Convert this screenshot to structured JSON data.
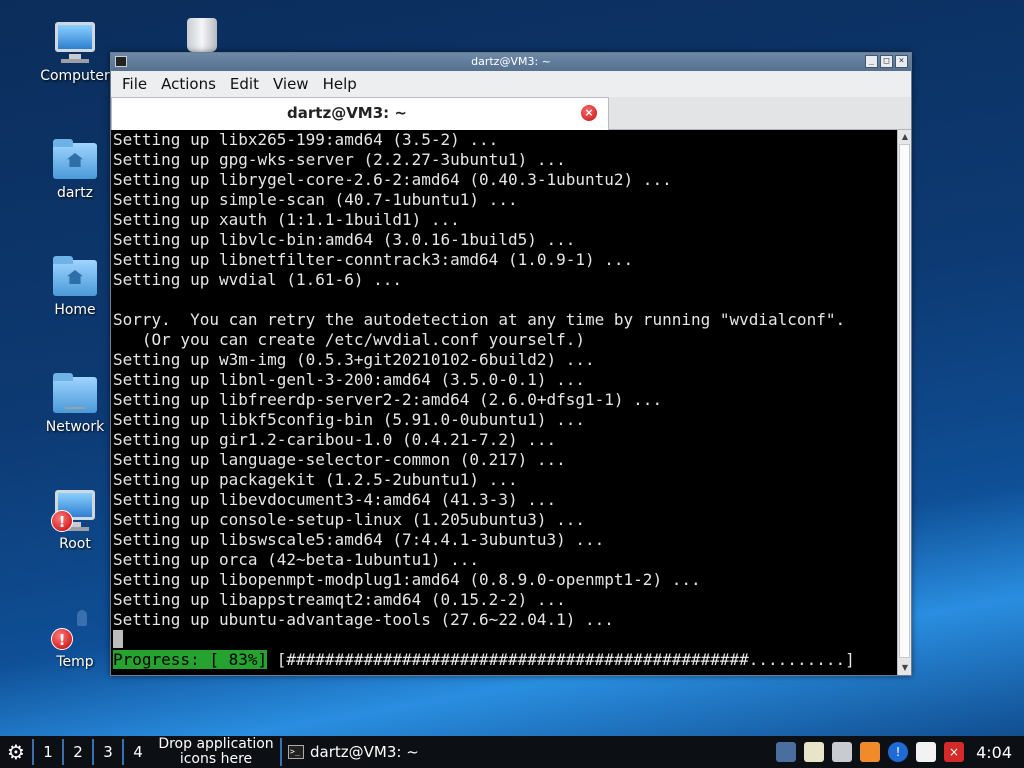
{
  "desktop": {
    "icons": [
      {
        "label": "Computer"
      },
      {
        "label": "dartz"
      },
      {
        "label": "Home"
      },
      {
        "label": "Network"
      },
      {
        "label": "Root"
      },
      {
        "label": "Temp"
      }
    ]
  },
  "window": {
    "title": "dartz@VM3: ~",
    "menu": [
      "File",
      "Actions",
      "Edit",
      "View",
      "Help"
    ],
    "tab_title": "dartz@VM3: ~",
    "buttons": {
      "minimize": "_",
      "maximize": "□",
      "close": "×"
    }
  },
  "terminal": {
    "lines": [
      "Setting up libx265-199:amd64 (3.5-2) ...",
      "Setting up gpg-wks-server (2.2.27-3ubuntu1) ...",
      "Setting up librygel-core-2.6-2:amd64 (0.40.3-1ubuntu2) ...",
      "Setting up simple-scan (40.7-1ubuntu1) ...",
      "Setting up xauth (1:1.1-1build1) ...",
      "Setting up libvlc-bin:amd64 (3.0.16-1build5) ...",
      "Setting up libnetfilter-conntrack3:amd64 (1.0.9-1) ...",
      "Setting up wvdial (1.61-6) ...",
      "",
      "Sorry.  You can retry the autodetection at any time by running \"wvdialconf\".",
      "   (Or you can create /etc/wvdial.conf yourself.)",
      "Setting up w3m-img (0.5.3+git20210102-6build2) ...",
      "Setting up libnl-genl-3-200:amd64 (3.5.0-0.1) ...",
      "Setting up libfreerdp-server2-2:amd64 (2.6.0+dfsg1-1) ...",
      "Setting up libkf5config-bin (5.91.0-0ubuntu1) ...",
      "Setting up gir1.2-caribou-1.0 (0.4.21-7.2) ...",
      "Setting up language-selector-common (0.217) ...",
      "Setting up packagekit (1.2.5-2ubuntu1) ...",
      "Setting up libevdocument3-4:amd64 (41.3-3) ...",
      "Setting up console-setup-linux (1.205ubuntu3) ...",
      "Setting up libswscale5:amd64 (7:4.4.1-3ubuntu3) ...",
      "Setting up orca (42~beta-1ubuntu1) ...",
      "Setting up libopenmpt-modplug1:amd64 (0.8.9.0-openmpt1-2) ...",
      "Setting up libappstreamqt2:amd64 (0.15.2-2) ...",
      "Setting up ubuntu-advantage-tools (27.6~22.04.1) ..."
    ],
    "progress_label": "Progress: [ 83%]",
    "progress_bar": "[################################################..........]",
    "progress_percent": 83
  },
  "taskbar": {
    "workspaces": [
      "1",
      "2",
      "3",
      "4"
    ],
    "drop_text": "Drop application icons here",
    "task_title": "dartz@VM3: ~",
    "clock": "4:04"
  },
  "colors": {
    "progress_green": "#26a22e",
    "terminal_bg": "#000000",
    "accent": "#3b6fb0"
  }
}
